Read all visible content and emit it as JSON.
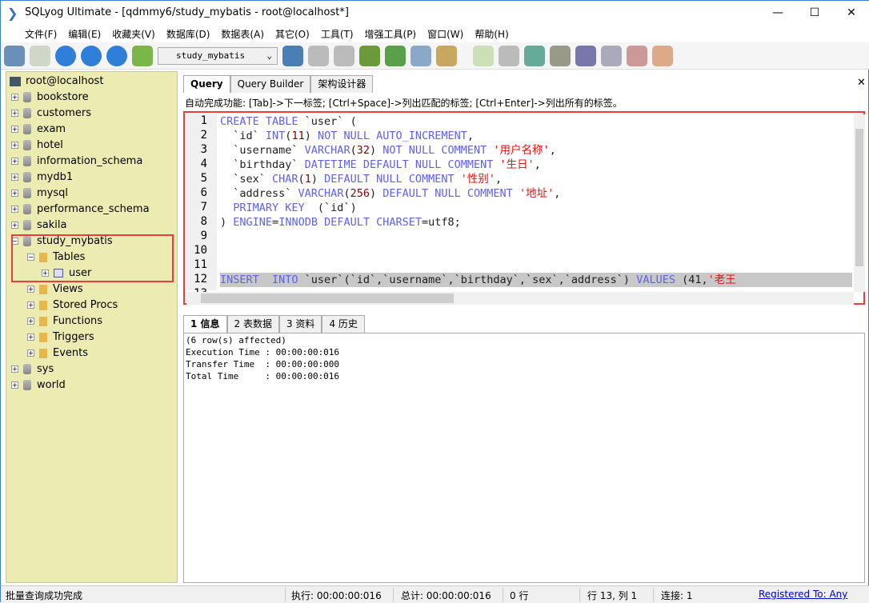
{
  "window": {
    "title": "SQLyog Ultimate - [qdmmy6/study_mybatis - root@localhost*]",
    "minimize": "—",
    "maximize": "☐",
    "close": "✕"
  },
  "menu": [
    "文件(F)",
    "编辑(E)",
    "收藏夹(V)",
    "数据库(D)",
    "数据表(A)",
    "其它(O)",
    "工具(T)",
    "增强工具(P)",
    "窗口(W)",
    "帮助(H)"
  ],
  "toolbar": {
    "database_select": "study_mybatis"
  },
  "sidebar": {
    "root": "root@localhost",
    "databases": [
      "bookstore",
      "customers",
      "exam",
      "hotel",
      "information_schema",
      "mydb1",
      "mysql",
      "performance_schema",
      "sakila",
      "study_mybatis"
    ],
    "after": [
      "sys",
      "world"
    ],
    "expanded": {
      "tables": "Tables",
      "table": "user",
      "folders": [
        "Views",
        "Stored Procs",
        "Functions",
        "Triggers",
        "Events"
      ]
    }
  },
  "tabs": [
    "Query",
    "Query Builder",
    "架构设计器"
  ],
  "hint": "自动完成功能: [Tab]->下一标签; [Ctrl+Space]->列出匹配的标签; [Ctrl+Enter]->列出所有的标签。",
  "editor": {
    "lines": [
      [
        [
          "CREATE TABLE ",
          "k"
        ],
        [
          "`user` (",
          "p"
        ]
      ],
      [
        [
          "  `id` ",
          "p"
        ],
        [
          "INT",
          "k"
        ],
        [
          "(",
          "p"
        ],
        [
          "11",
          "n"
        ],
        [
          ") ",
          "p"
        ],
        [
          "NOT NULL AUTO_INCREMENT",
          "k"
        ],
        [
          ",",
          "p"
        ]
      ],
      [
        [
          "  `username` ",
          "p"
        ],
        [
          "VARCHAR",
          "k"
        ],
        [
          "(",
          "p"
        ],
        [
          "32",
          "n"
        ],
        [
          ") ",
          "p"
        ],
        [
          "NOT NULL COMMENT ",
          "k"
        ],
        [
          "'用户名称'",
          "s"
        ],
        [
          ",",
          "p"
        ]
      ],
      [
        [
          "  `birthday` ",
          "p"
        ],
        [
          "DATETIME DEFAULT NULL COMMENT ",
          "k"
        ],
        [
          "'生日'",
          "s"
        ],
        [
          ",",
          "p"
        ]
      ],
      [
        [
          "  `sex` ",
          "p"
        ],
        [
          "CHAR",
          "k"
        ],
        [
          "(",
          "p"
        ],
        [
          "1",
          "n"
        ],
        [
          ") ",
          "p"
        ],
        [
          "DEFAULT NULL COMMENT ",
          "k"
        ],
        [
          "'性别'",
          "s"
        ],
        [
          ",",
          "p"
        ]
      ],
      [
        [
          "  `address` ",
          "p"
        ],
        [
          "VARCHAR",
          "k"
        ],
        [
          "(",
          "p"
        ],
        [
          "256",
          "n"
        ],
        [
          ") ",
          "p"
        ],
        [
          "DEFAULT NULL COMMENT ",
          "k"
        ],
        [
          "'地址'",
          "s"
        ],
        [
          ",",
          "p"
        ]
      ],
      [
        [
          "  PRIMARY KEY",
          "k"
        ],
        [
          "  (`id`)",
          "p"
        ]
      ],
      [
        [
          ") ",
          "p"
        ],
        [
          "ENGINE",
          "k"
        ],
        [
          "=",
          "p"
        ],
        [
          "INNODB DEFAULT CHARSET",
          "k"
        ],
        [
          "=utf8;",
          "p"
        ]
      ],
      [],
      [],
      [],
      [
        [
          "INSERT  INTO ",
          "k"
        ],
        [
          "`user`(`id`,`username`,`birthday`,`sex`,`address`) ",
          "p"
        ],
        [
          "VALUES ",
          "k"
        ],
        [
          "(41,",
          "p"
        ],
        [
          "'老王",
          "s"
        ]
      ]
    ]
  },
  "bottom_tabs": [
    "1 信息",
    "2 表数据",
    "3 资料",
    "4 历史"
  ],
  "result": [
    "(6 row(s) affected)",
    "Execution Time : 00:00:00:016",
    "Transfer Time  : 00:00:00:000",
    "Total Time     : 00:00:00:016"
  ],
  "status": {
    "message": "批量查询成功完成",
    "exec": "执行: 00:00:00:016",
    "total": "总计: 00:00:00:016",
    "rows": "0 行",
    "pos": "行 13, 列 1",
    "conn": "连接: 1",
    "registered": "Registered To: Any"
  },
  "colors": {
    "keyword": "#6060f0",
    "string": "#f01010",
    "sidebar": "#ecebb2",
    "highlight": "#f03a3a"
  }
}
